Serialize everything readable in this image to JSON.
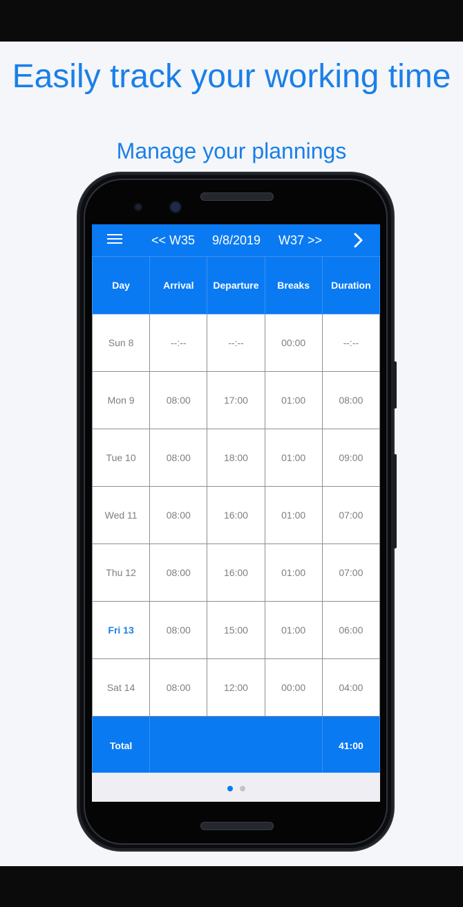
{
  "promo": {
    "headline": "Easily track your working time",
    "subheadline": "Manage your plannings"
  },
  "appbar": {
    "menu_icon": "hamburger-menu-icon",
    "prev_week": "<< W35",
    "current_date": "9/8/2019",
    "next_week": "W37 >>",
    "forward_icon": "chevron-right-icon"
  },
  "table": {
    "headers": [
      "Day",
      "Arrival",
      "Departure",
      "Breaks",
      "Duration"
    ],
    "rows": [
      {
        "day": "Sun 8",
        "arrival": "--:--",
        "departure": "--:--",
        "breaks": "00:00",
        "duration": "--:--",
        "today": false
      },
      {
        "day": "Mon 9",
        "arrival": "08:00",
        "departure": "17:00",
        "breaks": "01:00",
        "duration": "08:00",
        "today": false
      },
      {
        "day": "Tue 10",
        "arrival": "08:00",
        "departure": "18:00",
        "breaks": "01:00",
        "duration": "09:00",
        "today": false
      },
      {
        "day": "Wed 11",
        "arrival": "08:00",
        "departure": "16:00",
        "breaks": "01:00",
        "duration": "07:00",
        "today": false
      },
      {
        "day": "Thu 12",
        "arrival": "08:00",
        "departure": "16:00",
        "breaks": "01:00",
        "duration": "07:00",
        "today": false
      },
      {
        "day": "Fri 13",
        "arrival": "08:00",
        "departure": "15:00",
        "breaks": "01:00",
        "duration": "06:00",
        "today": true
      },
      {
        "day": "Sat 14",
        "arrival": "08:00",
        "departure": "12:00",
        "breaks": "00:00",
        "duration": "04:00",
        "today": false
      }
    ],
    "total_label": "Total",
    "total_value": "41:00"
  },
  "pager": {
    "pages": 2,
    "active_index": 0
  },
  "colors": {
    "accent": "#0a7af3",
    "headline": "#1a7fe8",
    "today_text": "#1a7fe8",
    "cell_text": "#7a7e84",
    "grid_line": "#8a8f96",
    "pager_bg": "#eeeef3"
  }
}
